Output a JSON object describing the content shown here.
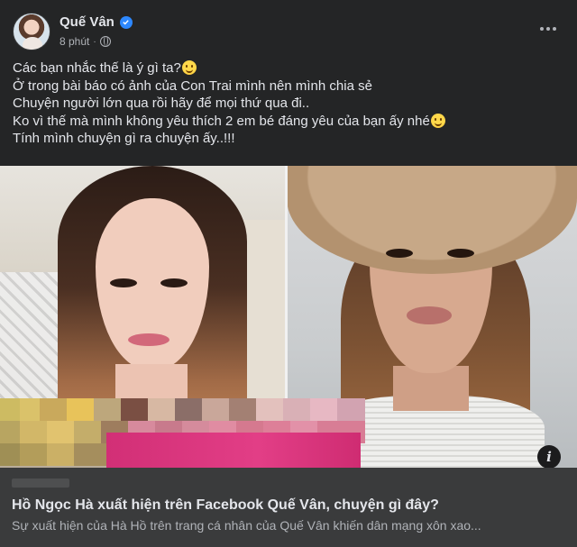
{
  "post": {
    "author_name": "Quế Vân",
    "time": "8 phút",
    "separator": "·",
    "lines": [
      "Các bạn nhắc thế là ý gì ta?",
      "Ở trong bài báo có ảnh của Con Trai mình nên mình chia sẻ",
      "Chuyện người lớn qua rồi hãy để mọi thứ qua đi..",
      "Ko vì thế mà mình không yêu thích 2 em bé đáng yêu của bạn ấy nhé",
      "Tính mình chuyện gì ra chuyện ấy..!!!"
    ],
    "icons": {
      "verified": "verified-badge-icon",
      "privacy": "globe-icon",
      "more": "more-options-icon",
      "info": "info-icon",
      "emoji_wink": "winking-face-emoji",
      "emoji_smile": "smiling-face-emoji"
    },
    "info_label": "i"
  },
  "link_preview": {
    "title": "Hồ Ngọc Hà xuất hiện trên Facebook Quế Vân, chuyện gì đây?",
    "description": "Sự xuất hiện của Hà Hồ trên trang cá nhân của Quế Vân khiến dân mạng xôn xao..."
  },
  "colors": {
    "background": "#242526",
    "text_primary": "#e4e6eb",
    "text_secondary": "#b0b3b8",
    "verified_blue": "#2d88ff",
    "link_box": "#3a3b3c"
  }
}
